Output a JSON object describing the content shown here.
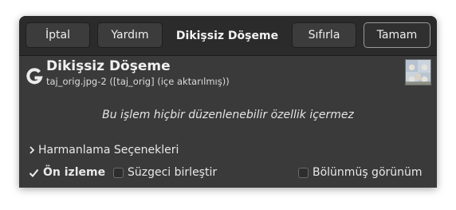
{
  "header": {
    "cancel_label": "İptal",
    "help_label": "Yardım",
    "title": "Dikişsiz Döşeme",
    "reset_label": "Sıfırla",
    "ok_label": "Tamam"
  },
  "plugin": {
    "name": "Dikişsiz Döşeme",
    "image_info": "taj_orig.jpg-2 ([taj_orig] (içe aktarılmış))",
    "icon": "gimp-g-icon",
    "thumbnail": "image-thumbnail"
  },
  "message": "Bu işlem hiçbir düzenlenebilir özellik içermez",
  "expander": {
    "label": "Harmanlama Seçenekleri",
    "expanded": false
  },
  "options": {
    "preview": {
      "label": "Ön izleme",
      "checked": true
    },
    "merge_filter": {
      "label": "Süzgeci birleştir",
      "checked": false
    },
    "split_view": {
      "label": "Bölünmüş görünüm",
      "checked": false
    }
  },
  "colors": {
    "window_bg": "#3a3a3a",
    "header_bg": "#2b2b2b",
    "text": "#e8e8e8"
  }
}
